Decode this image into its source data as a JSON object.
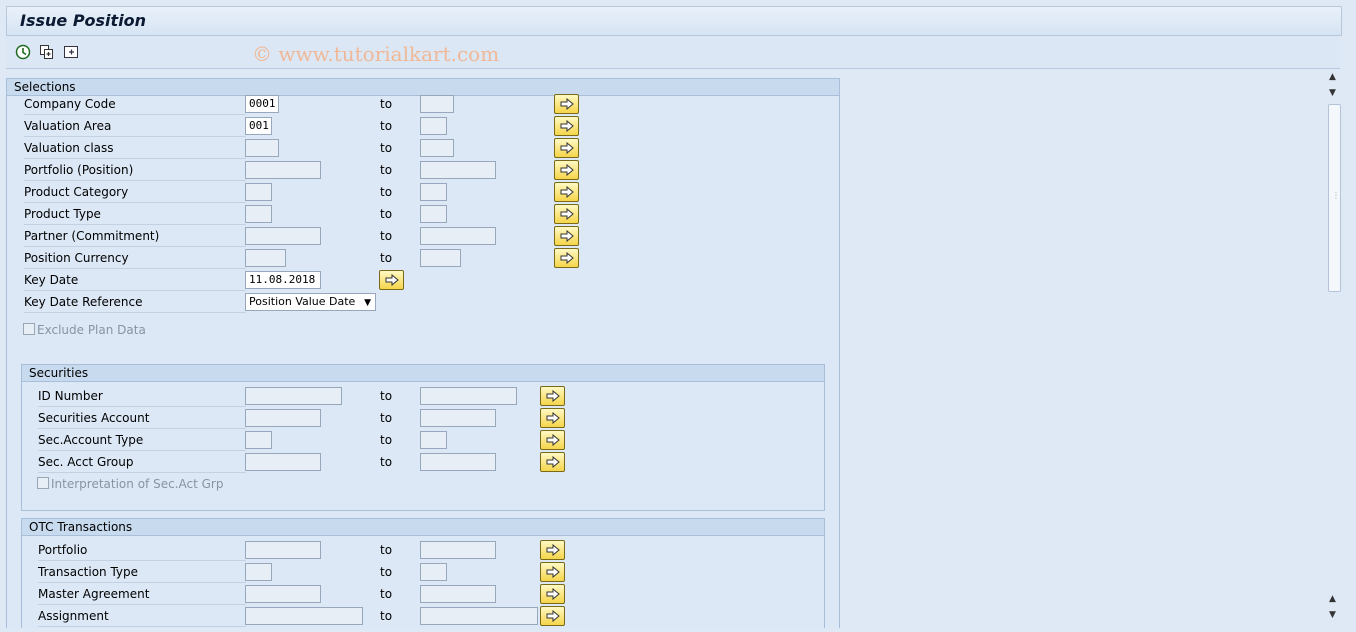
{
  "window": {
    "title": "Issue Position"
  },
  "watermark": "© www.tutorialkart.com",
  "toolbar": {
    "icons": [
      "execute-icon",
      "copy-variant-icon",
      "expand-icon"
    ]
  },
  "selections": {
    "title": "Selections",
    "rows": [
      {
        "label": "Company Code",
        "from": "0001",
        "to_label": "to",
        "to": ""
      },
      {
        "label": "Valuation Area",
        "from": "001",
        "to_label": "to",
        "to": ""
      },
      {
        "label": "Valuation class",
        "from": "",
        "to_label": "to",
        "to": ""
      },
      {
        "label": "Portfolio (Position)",
        "from": "",
        "to_label": "to",
        "to": ""
      },
      {
        "label": "Product Category",
        "from": "",
        "to_label": "to",
        "to": ""
      },
      {
        "label": "Product Type",
        "from": "",
        "to_label": "to",
        "to": ""
      },
      {
        "label": "Partner (Commitment)",
        "from": "",
        "to_label": "to",
        "to": ""
      },
      {
        "label": "Position Currency",
        "from": "",
        "to_label": "to",
        "to": ""
      }
    ],
    "key_date": {
      "label": "Key Date",
      "value": "11.08.2018"
    },
    "key_date_reference": {
      "label": "Key Date Reference",
      "value": "Position Value Date"
    },
    "exclude_plan_data": {
      "label": "Exclude Plan Data",
      "checked": false
    }
  },
  "securities": {
    "title": "Securities",
    "rows": [
      {
        "label": "ID Number",
        "from": "",
        "to_label": "to",
        "to": ""
      },
      {
        "label": "Securities Account",
        "from": "",
        "to_label": "to",
        "to": ""
      },
      {
        "label": "Sec.Account Type",
        "from": "",
        "to_label": "to",
        "to": ""
      },
      {
        "label": "Sec. Acct Group",
        "from": "",
        "to_label": "to",
        "to": ""
      }
    ],
    "interpretation": {
      "label": "Interpretation of Sec.Act Grp",
      "checked": false
    }
  },
  "otc": {
    "title": "OTC Transactions",
    "rows": [
      {
        "label": "Portfolio",
        "from": "",
        "to_label": "to",
        "to": ""
      },
      {
        "label": "Transaction Type",
        "from": "",
        "to_label": "to",
        "to": ""
      },
      {
        "label": "Master Agreement",
        "from": "",
        "to_label": "to",
        "to": ""
      },
      {
        "label": "Assignment",
        "from": "",
        "to_label": "to",
        "to": ""
      }
    ]
  },
  "colors": {
    "background": "#dfe9f5",
    "group_header": "#c7daee",
    "button_yellow": "#f5d54a"
  }
}
